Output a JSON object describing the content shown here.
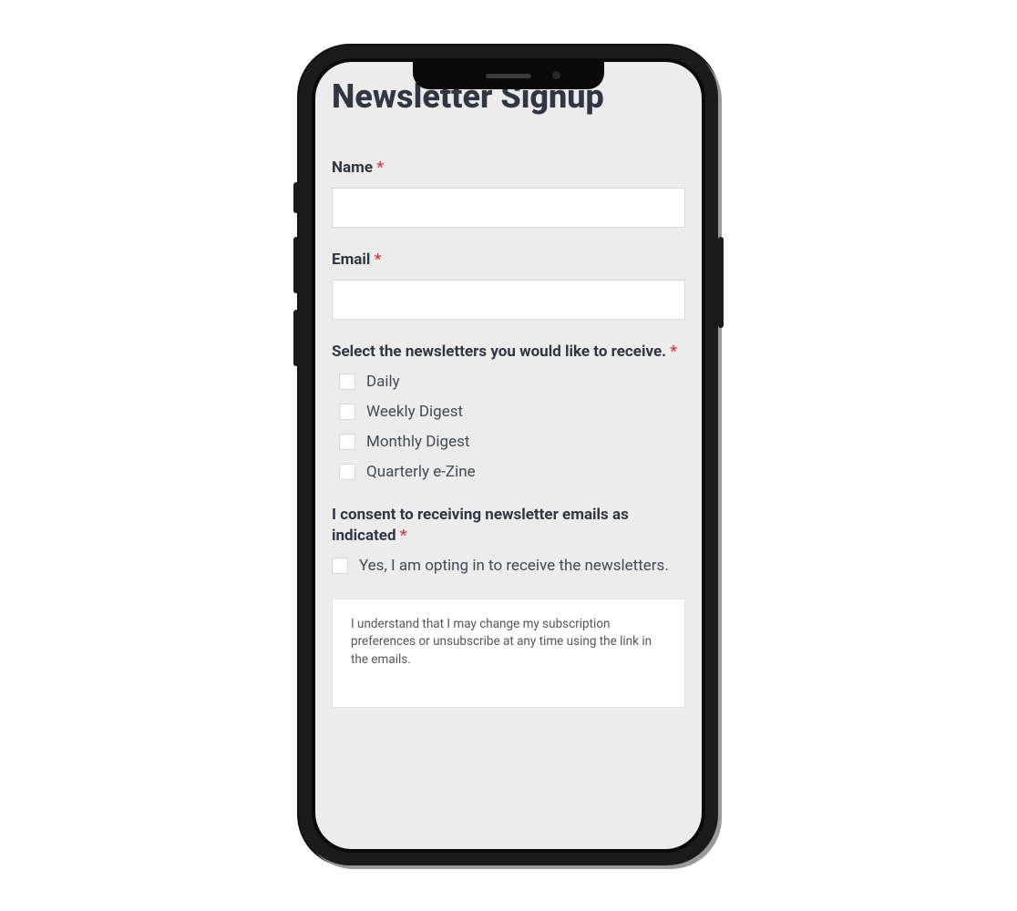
{
  "title": "Newsletter Signup",
  "required_mark": "*",
  "fields": {
    "name": {
      "label": "Name",
      "value": ""
    },
    "email": {
      "label": "Email",
      "value": ""
    }
  },
  "newsletters": {
    "label": "Select the newsletters you would like to receive.",
    "options": [
      "Daily",
      "Weekly Digest",
      "Monthly Digest",
      "Quarterly e-Zine"
    ]
  },
  "consent": {
    "label": "I consent to receiving newsletter emails as indicated",
    "option": "Yes, I am opting in to receive the newsletters."
  },
  "disclaimer": "I understand that I may change my subscription preferences or unsubscribe at any time using the link in the emails."
}
